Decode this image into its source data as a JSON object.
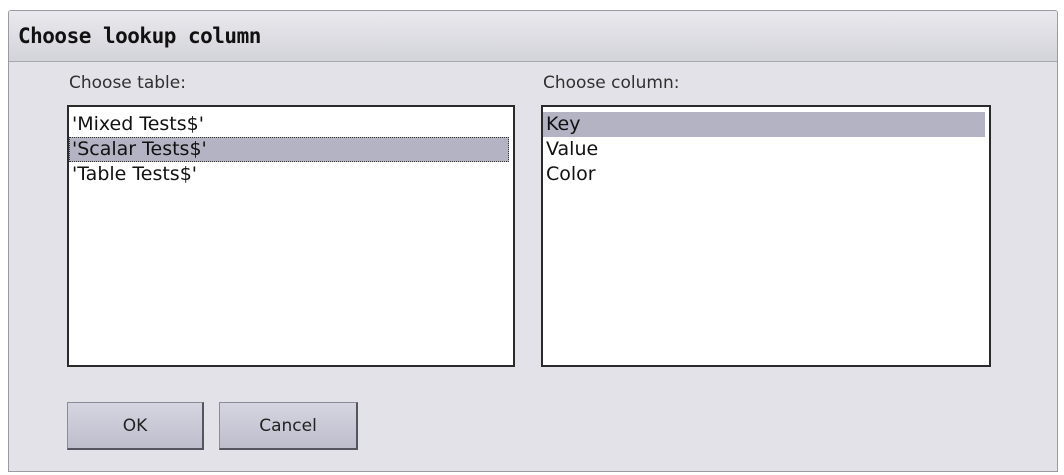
{
  "dialog": {
    "title": "Choose lookup column"
  },
  "table_section": {
    "label": "Choose table:",
    "items": [
      "'Mixed Tests$'",
      "'Scalar Tests$'",
      "'Table Tests$'"
    ],
    "selected": "'Scalar Tests$'"
  },
  "column_section": {
    "label": "Choose column:",
    "items": [
      "Key",
      "Value",
      "Color"
    ],
    "selected": "Key"
  },
  "buttons": {
    "ok_label": "OK",
    "cancel_label": "Cancel"
  },
  "colors": {
    "dialog_bg": "#e2e2e8",
    "selection_bg": "#b3b3c4",
    "list_border": "#2a2a2a"
  }
}
